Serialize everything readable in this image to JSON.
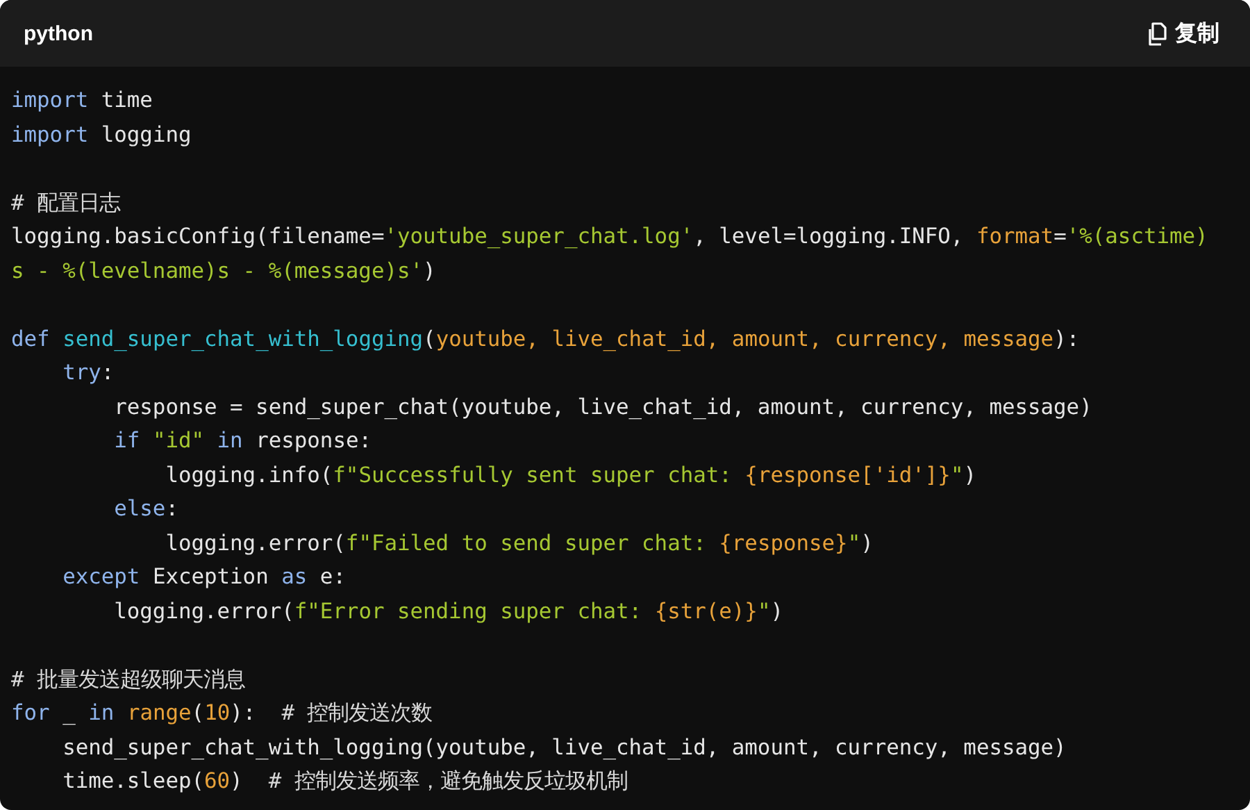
{
  "header": {
    "language": "python",
    "copy_button": "复制"
  },
  "lines": [
    {
      "kind": "code",
      "tokens": [
        {
          "kind": "keyword",
          "text": "import"
        },
        {
          "kind": "plain",
          "text": " time"
        }
      ]
    },
    {
      "kind": "code",
      "tokens": [
        {
          "kind": "keyword",
          "text": "import"
        },
        {
          "kind": "plain",
          "text": " logging"
        }
      ]
    },
    {
      "kind": "blank"
    },
    {
      "kind": "code",
      "tokens": [
        {
          "kind": "comment",
          "text": "# 配置日志"
        }
      ]
    },
    {
      "kind": "code",
      "tokens": [
        {
          "kind": "plain",
          "text": "logging.basicConfig(filename="
        },
        {
          "kind": "string",
          "text": "'youtube_super_chat.log'"
        },
        {
          "kind": "plain",
          "text": ", level=logging.INFO, "
        },
        {
          "kind": "param",
          "text": "format"
        },
        {
          "kind": "plain",
          "text": "="
        },
        {
          "kind": "string",
          "text": "'%(asctime)"
        }
      ]
    },
    {
      "kind": "code",
      "tokens": [
        {
          "kind": "string",
          "text": "s - %(levelname)s - %(message)s'"
        },
        {
          "kind": "plain",
          "text": ")"
        }
      ]
    },
    {
      "kind": "blank"
    },
    {
      "kind": "code",
      "tokens": [
        {
          "kind": "keyword",
          "text": "def "
        },
        {
          "kind": "function",
          "text": "send_super_chat_with_logging"
        },
        {
          "kind": "plain",
          "text": "("
        },
        {
          "kind": "param",
          "text": "youtube, live_chat_id, amount, currency, message"
        },
        {
          "kind": "plain",
          "text": "):"
        }
      ]
    },
    {
      "kind": "code",
      "tokens": [
        {
          "kind": "keyword",
          "text": "    try"
        },
        {
          "kind": "plain",
          "text": ":"
        }
      ]
    },
    {
      "kind": "code",
      "tokens": [
        {
          "kind": "plain",
          "text": "        response = send_super_chat(youtube, live_chat_id, amount, currency, message)"
        }
      ]
    },
    {
      "kind": "code",
      "tokens": [
        {
          "kind": "keyword",
          "text": "        if "
        },
        {
          "kind": "string",
          "text": "\"id\""
        },
        {
          "kind": "keyword",
          "text": " in"
        },
        {
          "kind": "plain",
          "text": " response:"
        }
      ]
    },
    {
      "kind": "code",
      "tokens": [
        {
          "kind": "plain",
          "text": "            logging.info("
        },
        {
          "kind": "string",
          "text": "f\"Successfully sent super chat: "
        },
        {
          "kind": "param",
          "text": "{response['id']}"
        },
        {
          "kind": "string",
          "text": "\""
        },
        {
          "kind": "plain",
          "text": ")"
        }
      ]
    },
    {
      "kind": "code",
      "tokens": [
        {
          "kind": "keyword",
          "text": "        else"
        },
        {
          "kind": "plain",
          "text": ":"
        }
      ]
    },
    {
      "kind": "code",
      "tokens": [
        {
          "kind": "plain",
          "text": "            logging.error("
        },
        {
          "kind": "string",
          "text": "f\"Failed to send super chat: "
        },
        {
          "kind": "param",
          "text": "{response}"
        },
        {
          "kind": "string",
          "text": "\""
        },
        {
          "kind": "plain",
          "text": ")"
        }
      ]
    },
    {
      "kind": "code",
      "tokens": [
        {
          "kind": "keyword",
          "text": "    except"
        },
        {
          "kind": "plain",
          "text": " Exception "
        },
        {
          "kind": "keyword",
          "text": "as"
        },
        {
          "kind": "plain",
          "text": " e:"
        }
      ]
    },
    {
      "kind": "code",
      "tokens": [
        {
          "kind": "plain",
          "text": "        logging.error("
        },
        {
          "kind": "string",
          "text": "f\"Error sending super chat: "
        },
        {
          "kind": "param",
          "text": "{str(e)}"
        },
        {
          "kind": "string",
          "text": "\""
        },
        {
          "kind": "plain",
          "text": ")"
        }
      ]
    },
    {
      "kind": "blank"
    },
    {
      "kind": "code",
      "tokens": [
        {
          "kind": "comment",
          "text": "# 批量发送超级聊天消息"
        }
      ]
    },
    {
      "kind": "code",
      "tokens": [
        {
          "kind": "keyword",
          "text": "for"
        },
        {
          "kind": "plain",
          "text": " _ "
        },
        {
          "kind": "keyword",
          "text": "in "
        },
        {
          "kind": "param",
          "text": "range"
        },
        {
          "kind": "plain",
          "text": "("
        },
        {
          "kind": "param",
          "text": "10"
        },
        {
          "kind": "plain",
          "text": "):  "
        },
        {
          "kind": "comment",
          "text": "# 控制发送次数"
        }
      ]
    },
    {
      "kind": "code",
      "tokens": [
        {
          "kind": "plain",
          "text": "    send_super_chat_with_logging(youtube, live_chat_id, amount, currency, message)"
        }
      ]
    },
    {
      "kind": "code",
      "tokens": [
        {
          "kind": "plain",
          "text": "    time.sleep("
        },
        {
          "kind": "param",
          "text": "60"
        },
        {
          "kind": "plain",
          "text": ")  "
        },
        {
          "kind": "comment",
          "text": "# 控制发送频率，避免触发反垃圾机制"
        }
      ]
    }
  ]
}
